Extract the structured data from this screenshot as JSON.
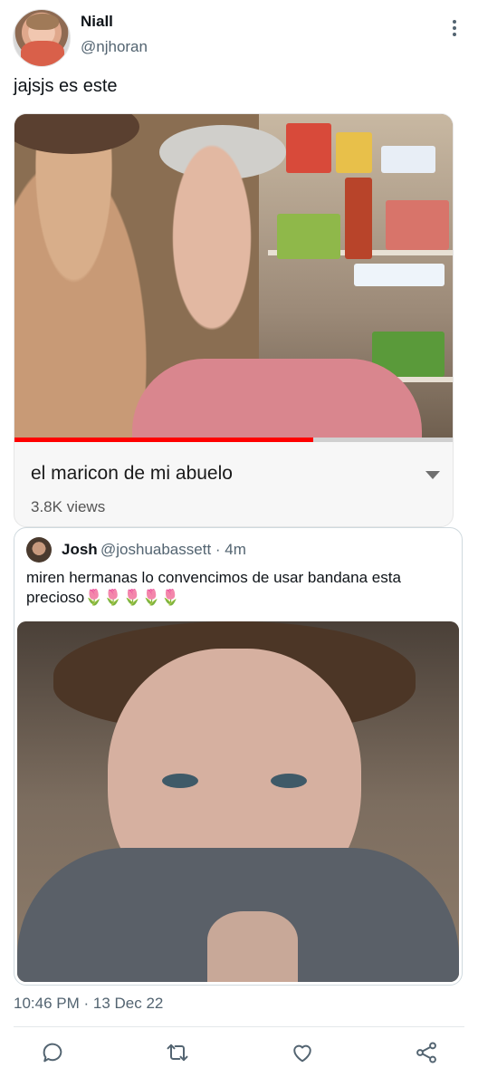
{
  "author": {
    "name": "Niall",
    "handle": "@njhoran"
  },
  "tweet": {
    "text": "jajsjs es este"
  },
  "video_card": {
    "title": "el maricon de mi abuelo",
    "views": "3.8K views",
    "progress": 0.68
  },
  "quoted_tweet": {
    "name": "Josh",
    "handle_time": "@joshuabassett · 4m",
    "text": "miren hermanas lo convencimos de usar bandana esta precioso🌷🌷🌷🌷🌷"
  },
  "timestamp": "10:46 PM · 13 Dec 22",
  "icons": [
    "more-vertical-icon",
    "reply-icon",
    "retweet-icon",
    "like-icon",
    "share-icon"
  ],
  "colors": {
    "handle_gray": "#536471",
    "progress_red": "#ff0000"
  }
}
